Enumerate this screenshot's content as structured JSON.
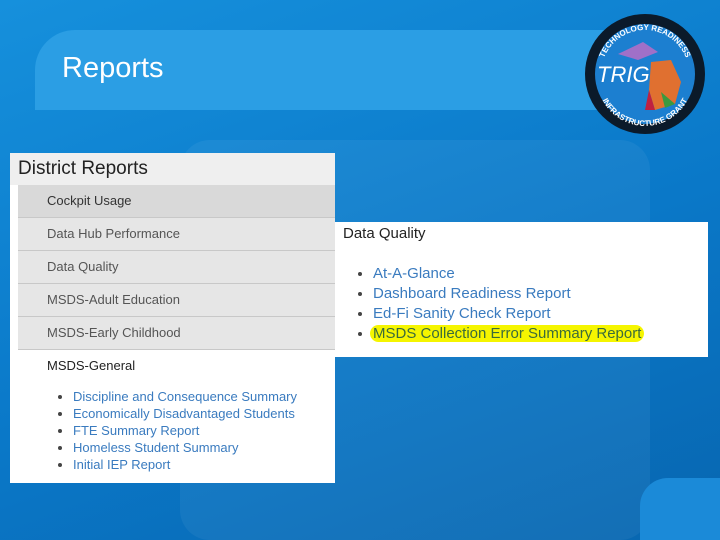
{
  "slide": {
    "title": "Reports"
  },
  "logo": {
    "top_text": "TECHNOLOGY READINESS",
    "center_text": "TRIG",
    "bottom_text": "INFRASTRUCTURE GRANT"
  },
  "district": {
    "heading": "District Reports",
    "items": [
      "Cockpit Usage",
      "Data Hub Performance",
      "Data Quality",
      "MSDS-Adult Education",
      "MSDS-Early Childhood",
      "MSDS-General"
    ],
    "general_links": [
      "Discipline and Consequence Summary",
      "Economically Disadvantaged Students",
      "FTE Summary Report",
      "Homeless Student Summary",
      "Initial IEP Report"
    ]
  },
  "data_quality": {
    "heading": "Data Quality",
    "links": [
      "At-A-Glance",
      "Dashboard Readiness Report",
      "Ed-Fi Sanity Check Report",
      "MSDS Collection Error Summary Report"
    ],
    "highlight_color": "#f5f500"
  }
}
